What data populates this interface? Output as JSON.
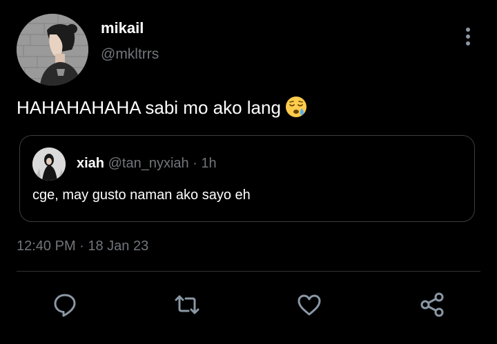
{
  "colors": {
    "background": "#000000",
    "text_primary": "#ffffff",
    "text_secondary": "#71767b",
    "border": "#3a3d40",
    "icon": "#8b98a5"
  },
  "tweet": {
    "author_name": "mikail",
    "author_handle": "@mkltrrs",
    "text": "HAHAHAHAHA sabi mo ako lang",
    "emoji": "sleepy-face-emoji",
    "timestamp": "12:40 PM · 18 Jan 23"
  },
  "quoted_tweet": {
    "author_name": "xiah",
    "meta": "@tan_nyxiah · 1h",
    "text": "cge, may gusto naman ako sayo eh"
  },
  "icons": {
    "more": "more-vertical-icon",
    "reply": "reply-icon",
    "retweet": "retweet-icon",
    "like": "heart-icon",
    "share": "share-icon"
  }
}
